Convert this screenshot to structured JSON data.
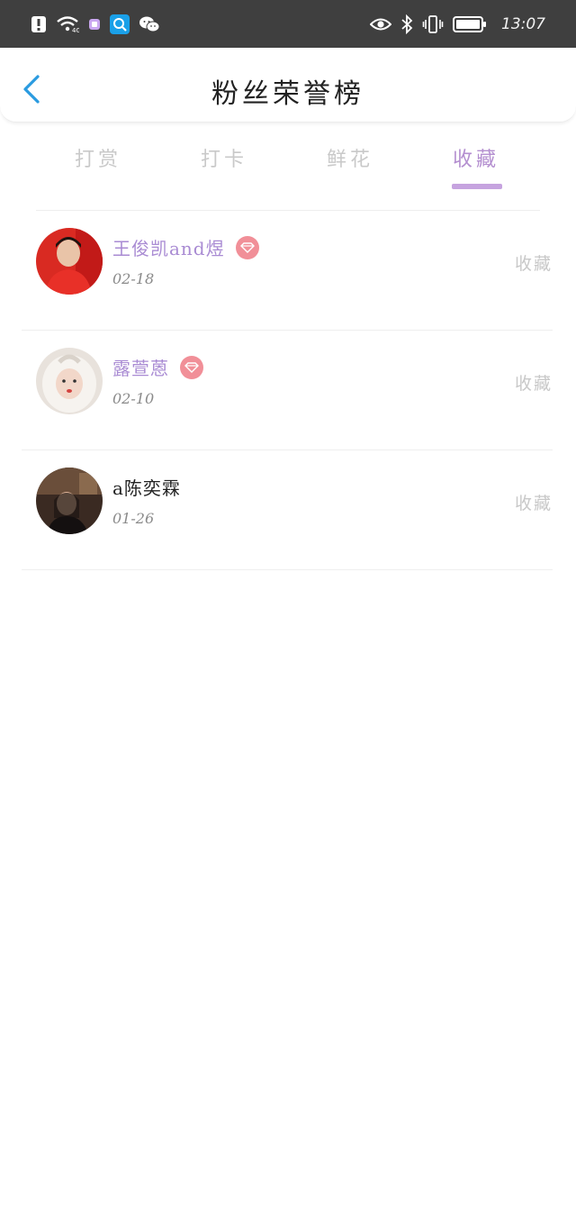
{
  "status_bar": {
    "time": "13:07",
    "left_icons": [
      "alert-icon",
      "wifi-icon",
      "app-icon",
      "search-app-icon",
      "wechat-icon"
    ],
    "right_icons": [
      "eye-icon",
      "bluetooth-icon",
      "vibrate-icon",
      "battery-icon"
    ]
  },
  "header": {
    "title": "粉丝荣誉榜",
    "back_icon": "chevron-left-icon"
  },
  "tabs": [
    {
      "label": "打赏",
      "active": false
    },
    {
      "label": "打卡",
      "active": false
    },
    {
      "label": "鲜花",
      "active": false
    },
    {
      "label": "收藏",
      "active": true
    }
  ],
  "fans": [
    {
      "name": "王俊凯and煜",
      "date": "02-18",
      "action": "收藏",
      "vip": true,
      "badge_icon": "diamond-icon"
    },
    {
      "name": "露萱蒽",
      "date": "02-10",
      "action": "收藏",
      "vip": true,
      "badge_icon": "diamond-icon"
    },
    {
      "name": "a陈奕霖",
      "date": "01-26",
      "action": "收藏",
      "vip": false
    }
  ],
  "colors": {
    "status_bar_bg": "#3f3f3f",
    "accent_purple": "#b48fd0",
    "vip_name": "#a98bd3",
    "badge": "#f18f98",
    "back_blue": "#2a9be0",
    "inactive_tab": "#c9c9c9"
  }
}
